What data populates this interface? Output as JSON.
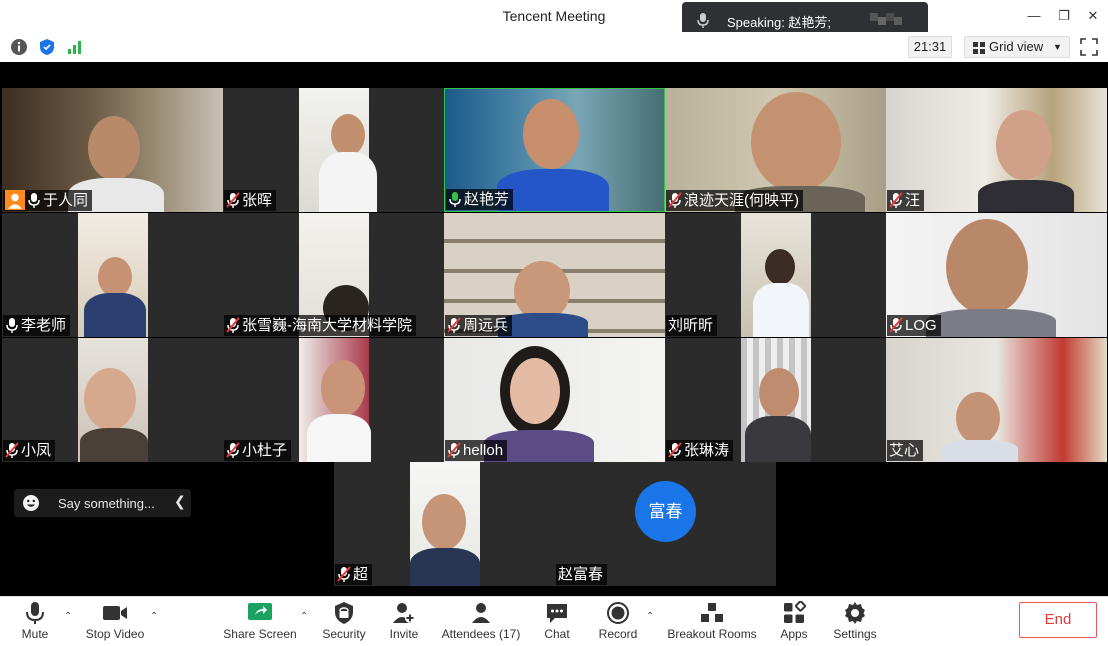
{
  "window": {
    "title": "Tencent Meeting"
  },
  "speaking": {
    "label": "Speaking: 赵艳芳;"
  },
  "toolstrip": {
    "time": "21:31",
    "view_label": "Grid view"
  },
  "participants": [
    {
      "name": "于人同"
    },
    {
      "name": "张晖"
    },
    {
      "name": "赵艳芳"
    },
    {
      "name": "浪迹天涯(何映平)"
    },
    {
      "name": "汪"
    },
    {
      "name": "李老师"
    },
    {
      "name": "张雪巍-海南大学材料学院"
    },
    {
      "name": "周远兵"
    },
    {
      "name": "刘昕昕"
    },
    {
      "name": "LOG"
    },
    {
      "name": "小凤"
    },
    {
      "name": "小杜子"
    },
    {
      "name": "helloh"
    },
    {
      "name": "张琳涛"
    },
    {
      "name": "艾心"
    },
    {
      "name": "超"
    },
    {
      "name": "赵富春",
      "avatar_text": "富春"
    }
  ],
  "chat": {
    "placeholder": "Say something..."
  },
  "toolbar": {
    "mute": "Mute",
    "stop_video": "Stop Video",
    "share_screen": "Share Screen",
    "security": "Security",
    "invite": "Invite",
    "attendees": "Attendees (17)",
    "chat": "Chat",
    "record": "Record",
    "breakout": "Breakout Rooms",
    "apps": "Apps",
    "settings": "Settings",
    "end": "End"
  },
  "colors": {
    "accent": "#1a76e8",
    "end": "#e03a3a",
    "share": "#1aa260",
    "speaking_green": "#35c24a"
  }
}
